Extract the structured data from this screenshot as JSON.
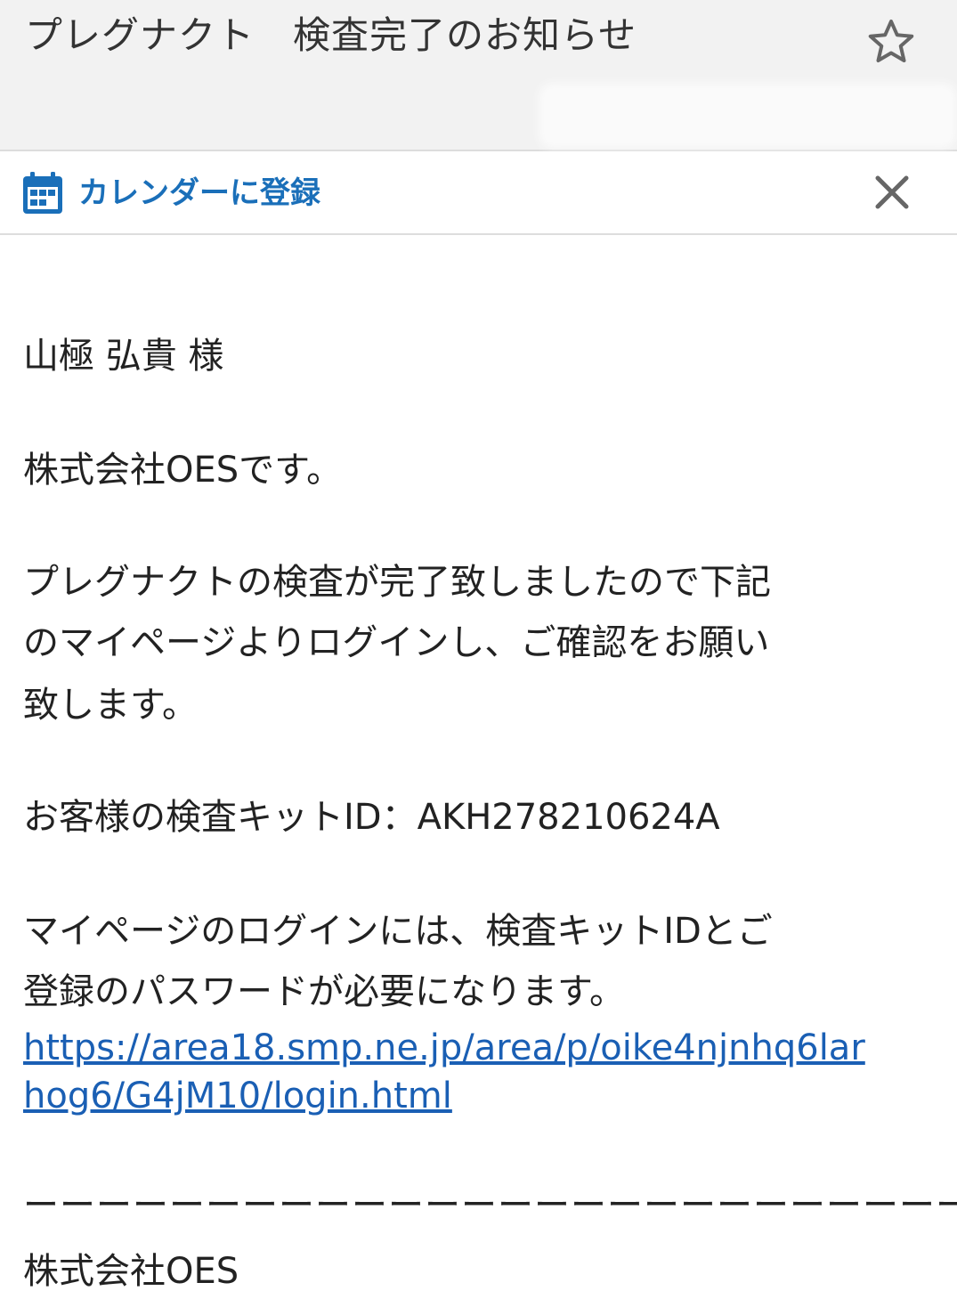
{
  "header": {
    "subject": "プレグナクト　検査完了のお知らせ",
    "star_icon": "star-outline-icon"
  },
  "calendar_bar": {
    "label": "カレンダーに登録",
    "calendar_icon": "calendar-icon",
    "close_icon": "close-icon",
    "accent_color": "#1a6fb9"
  },
  "email": {
    "recipient": "山極 弘貴 様",
    "greeting": "株式会社OESです。",
    "paragraph1_line1": "プレグナクトの検査が完了致しましたので下記",
    "paragraph1_line2": "のマイページよりログインし、ご確認をお願い",
    "paragraph1_line3": "致します。",
    "kit_id_line": "お客様の検査キットID：AKH278210624A",
    "paragraph2_line1": "マイページのログインには、検査キットIDとご",
    "paragraph2_line2": "登録のパスワードが必要になります。",
    "link_line1": "https://area18.smp.ne.jp/area/p/oike4njnhq6lar",
    "link_line2": "hog6/G4jM10/login.html",
    "divider": "ーーーーーーーーーーーーーーーーーーーーーーーーーー",
    "signature": "株式会社OES"
  }
}
